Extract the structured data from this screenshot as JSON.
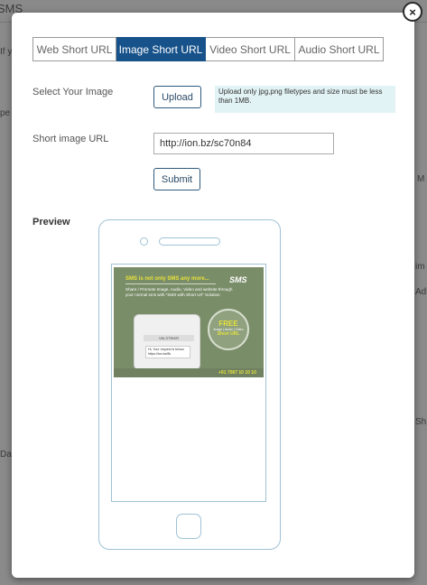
{
  "background": {
    "title": "SMS",
    "fragments": [
      "If y",
      "pe",
      "M",
      "im",
      "Ad",
      "Sh",
      "Da"
    ]
  },
  "modal": {
    "close_icon": "×",
    "tabs": [
      {
        "label": "Web Short URL",
        "active": false
      },
      {
        "label": "Image Short URL",
        "active": true
      },
      {
        "label": "Video Short URL",
        "active": false
      },
      {
        "label": "Audio Short URL",
        "active": false
      }
    ],
    "select_image_label": "Select Your Image",
    "upload_button": "Upload",
    "upload_note": "Upload only jpg,png filetypes and size must be less than 1MB.",
    "short_url_label": "Short image URL",
    "short_url_value": "http://ion.bz/sc70n84",
    "submit_button": "Submit",
    "preview_label": "Preview"
  },
  "banner": {
    "headline": "SMS is not only SMS any more...",
    "logo": "SMS",
    "body": "Share / Promote Image, Audio, Video and website through your normal sms with \"SMS with Short Url\" Solution",
    "mini_sender": "VM-STRIKR",
    "mini_message": "Hi, Your request is below. https://ion.bz/8k",
    "badge_free": "FREE",
    "badge_sub": "Image | Audio | Video",
    "badge_url": "Short URL",
    "phone": "+91 7087 10 10 10"
  },
  "colors": {
    "tab_active": "#17528a",
    "note_bg": "#e2f3f5",
    "banner_bg": "#7a8d69",
    "banner_accent": "#e6e23a"
  }
}
